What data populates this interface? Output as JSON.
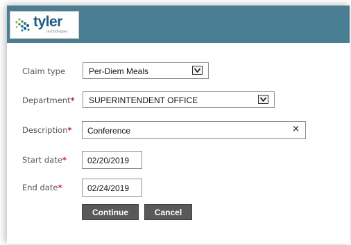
{
  "brand": {
    "name": "tyler",
    "tagline": "technologies"
  },
  "colors": {
    "header": "#4a7f93",
    "required": "#d02020",
    "button": "#595959"
  },
  "form": {
    "claim_type": {
      "label": "Claim type",
      "value": "Per-Diem Meals",
      "required": false
    },
    "department": {
      "label": "Department",
      "value": "SUPERINTENDENT OFFICE",
      "required": true
    },
    "description": {
      "label": "Description",
      "value": "Conference",
      "required": true
    },
    "start_date": {
      "label": "Start date",
      "value": "02/20/2019",
      "required": true
    },
    "end_date": {
      "label": "End date",
      "value": "02/24/2019",
      "required": true
    },
    "required_marker": "*"
  },
  "buttons": {
    "continue": "Continue",
    "cancel": "Cancel"
  },
  "icons": {
    "dropdown": "chevron-down-icon",
    "clear": "close-icon",
    "logo": "tyler-logo-icon"
  }
}
